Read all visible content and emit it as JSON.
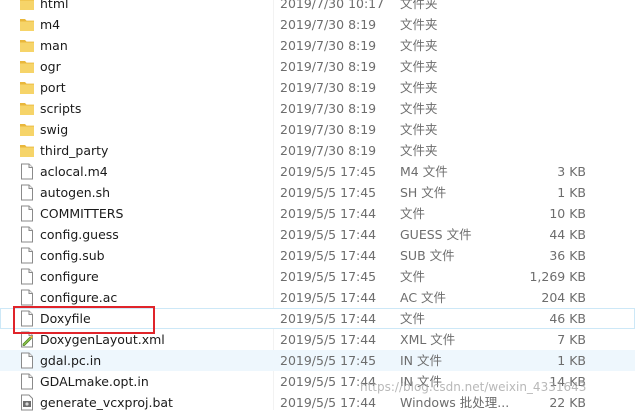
{
  "files": [
    {
      "name": "html",
      "date": "2019/7/30 10:17",
      "type": "文件夹",
      "size": "",
      "icon": "folder-icon"
    },
    {
      "name": "m4",
      "date": "2019/7/30 8:19",
      "type": "文件夹",
      "size": "",
      "icon": "folder-icon"
    },
    {
      "name": "man",
      "date": "2019/7/30 8:19",
      "type": "文件夹",
      "size": "",
      "icon": "folder-icon"
    },
    {
      "name": "ogr",
      "date": "2019/7/30 8:19",
      "type": "文件夹",
      "size": "",
      "icon": "folder-icon"
    },
    {
      "name": "port",
      "date": "2019/7/30 8:19",
      "type": "文件夹",
      "size": "",
      "icon": "folder-icon"
    },
    {
      "name": "scripts",
      "date": "2019/7/30 8:19",
      "type": "文件夹",
      "size": "",
      "icon": "folder-icon"
    },
    {
      "name": "swig",
      "date": "2019/7/30 8:19",
      "type": "文件夹",
      "size": "",
      "icon": "folder-icon"
    },
    {
      "name": "third_party",
      "date": "2019/7/30 8:19",
      "type": "文件夹",
      "size": "",
      "icon": "folder-icon"
    },
    {
      "name": "aclocal.m4",
      "date": "2019/5/5 17:45",
      "type": "M4 文件",
      "size": "3 KB",
      "icon": "file-icon"
    },
    {
      "name": "autogen.sh",
      "date": "2019/5/5 17:45",
      "type": "SH 文件",
      "size": "1 KB",
      "icon": "file-icon"
    },
    {
      "name": "COMMITTERS",
      "date": "2019/5/5 17:44",
      "type": "文件",
      "size": "10 KB",
      "icon": "file-icon"
    },
    {
      "name": "config.guess",
      "date": "2019/5/5 17:44",
      "type": "GUESS 文件",
      "size": "44 KB",
      "icon": "file-icon"
    },
    {
      "name": "config.sub",
      "date": "2019/5/5 17:44",
      "type": "SUB 文件",
      "size": "36 KB",
      "icon": "file-icon"
    },
    {
      "name": "configure",
      "date": "2019/5/5 17:45",
      "type": "文件",
      "size": "1,269 KB",
      "icon": "file-icon"
    },
    {
      "name": "configure.ac",
      "date": "2019/5/5 17:44",
      "type": "AC 文件",
      "size": "204 KB",
      "icon": "file-icon"
    },
    {
      "name": "Doxyfile",
      "date": "2019/5/5 17:44",
      "type": "文件",
      "size": "46 KB",
      "icon": "file-icon"
    },
    {
      "name": "DoxygenLayout.xml",
      "date": "2019/5/5 17:44",
      "type": "XML 文件",
      "size": "7 KB",
      "icon": "xml-file-icon"
    },
    {
      "name": "gdal.pc.in",
      "date": "2019/5/5 17:45",
      "type": "IN 文件",
      "size": "1 KB",
      "icon": "file-icon"
    },
    {
      "name": "GDALmake.opt.in",
      "date": "2019/5/5 17:44",
      "type": "IN 文件",
      "size": "14 KB",
      "icon": "file-icon"
    },
    {
      "name": "generate_vcxproj.bat",
      "date": "2019/5/5 17:44",
      "type": "Windows 批处理...",
      "size": "22 KB",
      "icon": "bat-file-icon"
    }
  ],
  "watermark": "https://blog.csdn.net/weixin_4331643",
  "colors": {
    "folder": "#f0c850",
    "highlight": "#e0242a",
    "hover": "#e5f3fb"
  }
}
